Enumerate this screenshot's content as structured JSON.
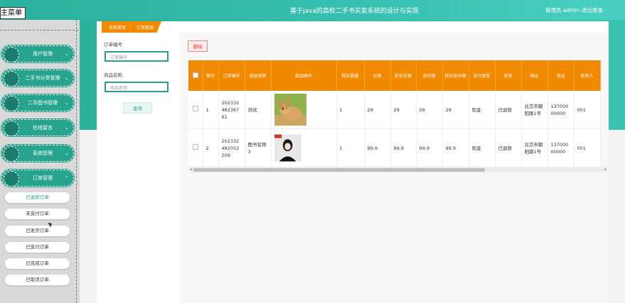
{
  "header": {
    "title": "基于java的高校二手书买卖系统的设计与实现",
    "user": "管理员 admin",
    "logout": "退出登录"
  },
  "menu_toggle": "主菜单",
  "sidebar": {
    "items": [
      {
        "label": "用户管理",
        "chevron": "⌄"
      },
      {
        "label": "二手书分类管理",
        "chevron": "⌄"
      },
      {
        "label": "二手图书管理",
        "chevron": "⌄"
      },
      {
        "label": "在线留言",
        "chevron": "⌄"
      },
      {
        "label": "系统管理",
        "chevron": "⌄"
      },
      {
        "label": "订单管理",
        "chevron": "⌃"
      }
    ],
    "sub_items": [
      {
        "label": "已退款订单"
      },
      {
        "label": "未支付订单"
      },
      {
        "label": "已发货订单"
      },
      {
        "label": "已支付订单"
      },
      {
        "label": "已完成订单"
      },
      {
        "label": "已取消订单"
      }
    ]
  },
  "breadcrumb": {
    "home": "系统首页",
    "sep": "⁝",
    "current": "订单管理"
  },
  "search": {
    "order_no_label": "订单编号",
    "order_no_placeholder": "订单编号",
    "goods_name_label": "商品名称",
    "goods_name_placeholder": "商品名称",
    "search_button": "查询"
  },
  "toolbar": {
    "delete_button": "删除"
  },
  "table": {
    "headers": [
      "索引",
      "订单编号",
      "商品名称",
      "商品图片",
      "购买数量",
      "价格",
      "折扣价格",
      "总价格",
      "折扣总价格",
      "支付类型",
      "状态",
      "地址",
      "电话",
      "收货人"
    ],
    "rows": [
      {
        "index": "1",
        "order_no": "20233248236761",
        "goods_name": "测试",
        "image": "rabbit-photo",
        "qty": "1",
        "price": "29",
        "discount_price": "29",
        "total": "29",
        "discount_total": "29",
        "pay_type": "现金",
        "status": "已退款",
        "address": "北京市朝阳路1号",
        "phone": "13700000000",
        "receiver": "001"
      },
      {
        "index": "2",
        "order_no": "202332482052209",
        "goods_name": "图书名称3",
        "image": "book-cover-photo",
        "qty": "1",
        "price": "99.9",
        "discount_price": "99.9",
        "total": "99.9",
        "discount_total": "99.9",
        "pay_type": "现金",
        "status": "已退款",
        "address": "北京市朝阳路1号",
        "phone": "13700000000",
        "receiver": "001"
      }
    ]
  },
  "colors": {
    "accent": "#2aa08b",
    "orange": "#f18a00",
    "header_teal": "#38c1b0"
  }
}
